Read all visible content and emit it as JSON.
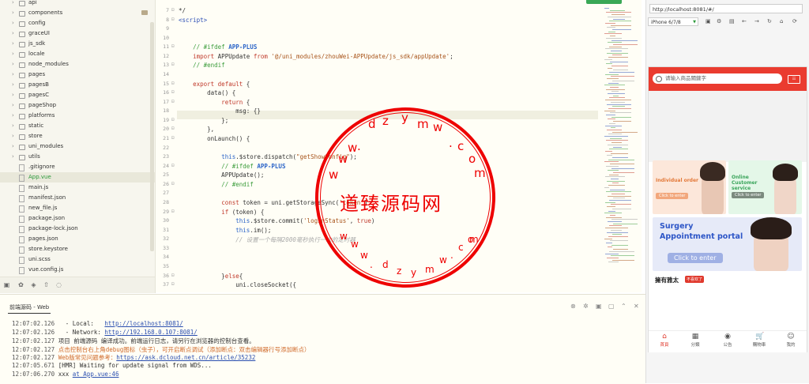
{
  "sidebar": {
    "items": [
      {
        "label": "api",
        "type": "folder"
      },
      {
        "label": "components",
        "type": "folder"
      },
      {
        "label": "config",
        "type": "folder"
      },
      {
        "label": "graceUI",
        "type": "folder"
      },
      {
        "label": "js_sdk",
        "type": "folder"
      },
      {
        "label": "locale",
        "type": "folder"
      },
      {
        "label": "node_modules",
        "type": "folder"
      },
      {
        "label": "pages",
        "type": "folder"
      },
      {
        "label": "pagesB",
        "type": "folder"
      },
      {
        "label": "pagesC",
        "type": "folder"
      },
      {
        "label": "pageShop",
        "type": "folder"
      },
      {
        "label": "platforms",
        "type": "folder"
      },
      {
        "label": "static",
        "type": "folder"
      },
      {
        "label": "store",
        "type": "folder"
      },
      {
        "label": "uni_modules",
        "type": "folder"
      },
      {
        "label": "utils",
        "type": "folder"
      },
      {
        "label": ".gitignore",
        "type": "file"
      },
      {
        "label": "App.vue",
        "type": "file"
      },
      {
        "label": "main.js",
        "type": "file"
      },
      {
        "label": "manifest.json",
        "type": "file"
      },
      {
        "label": "new_file.js",
        "type": "file"
      },
      {
        "label": "package.json",
        "type": "file"
      },
      {
        "label": "package-lock.json",
        "type": "file"
      },
      {
        "label": "pages.json",
        "type": "file"
      },
      {
        "label": "store.keystore",
        "type": "file"
      },
      {
        "label": "uni.scss",
        "type": "file"
      },
      {
        "label": "vue.config.js",
        "type": "file"
      }
    ]
  },
  "editor": {
    "lines": [
      {
        "n": "7",
        "f": "⊟",
        "html": "*/"
      },
      {
        "n": "8",
        "f": "⊟",
        "html": "<span class='c-tag'>&lt;script&gt;</span>"
      },
      {
        "n": "9",
        "f": "",
        "html": ""
      },
      {
        "n": "10",
        "f": "",
        "html": ""
      },
      {
        "n": "11",
        "f": "⊟",
        "html": "    <span class='c-cm'>// #ifdef <b class='c-blue'>APP-PLUS</b></span>"
      },
      {
        "n": "12",
        "f": "",
        "html": "    <span class='c-kw'>import</span> APPUpdate <span class='c-kw'>from</span> <span class='c-str'>'@/uni_modules/zhouWei-APPUpdate/js_sdk/appUpdate'</span>;"
      },
      {
        "n": "13",
        "f": "⊟",
        "html": "    <span class='c-cm'>// #endif</span>"
      },
      {
        "n": "14",
        "f": "",
        "html": ""
      },
      {
        "n": "15",
        "f": "⊟",
        "html": "    <span class='c-kw'>export default</span> {"
      },
      {
        "n": "16",
        "f": "⊟",
        "html": "        data() {"
      },
      {
        "n": "17",
        "f": "⊟",
        "html": "            <span class='c-kw'>return</span> {"
      },
      {
        "n": "18",
        "f": "",
        "html": "                msg: {}"
      },
      {
        "n": "19",
        "f": "⊟",
        "html": "            };"
      },
      {
        "n": "20",
        "f": "⊟",
        "html": "        },"
      },
      {
        "n": "21",
        "f": "⊟",
        "html": "        onLaunch() {"
      },
      {
        "n": "22",
        "f": "",
        "html": ""
      },
      {
        "n": "23",
        "f": "",
        "html": "            <span class='c-blue'>this</span>.$store.dispatch(<span class='c-str'>\"getShowConfig\"</span>);"
      },
      {
        "n": "24",
        "f": "⊟",
        "html": "            <span class='c-cm'>// #ifdef <b class='c-blue'>APP-PLUS</b></span>"
      },
      {
        "n": "25",
        "f": "",
        "html": "            APPUpdate();"
      },
      {
        "n": "26",
        "f": "⊟",
        "html": "            <span class='c-cm'>// #endif</span>"
      },
      {
        "n": "27",
        "f": "",
        "html": ""
      },
      {
        "n": "28",
        "f": "",
        "html": "            <span class='c-kw'>const</span> token = uni.getStorageSync(<span class='c-str'>'token'</span>)"
      },
      {
        "n": "29",
        "f": "⊟",
        "html": "            <span class='c-kw'>if</span> (token) {"
      },
      {
        "n": "30",
        "f": "",
        "html": "                <span class='c-blue'>this</span>.$store.commit(<span class='c-str'>'loginStatus'</span>, <span class='c-kw'>true</span>)"
      },
      {
        "n": "31",
        "f": "",
        "html": "                <span class='c-blue'>this</span>.im();"
      },
      {
        "n": "32",
        "f": "",
        "html": "                <span class='c-gray'>// 设置一个每隔2000毫秒执行一次的定时器</span>"
      },
      {
        "n": "33",
        "f": "",
        "html": ""
      },
      {
        "n": "34",
        "f": "",
        "html": ""
      },
      {
        "n": "35",
        "f": "",
        "html": ""
      },
      {
        "n": "36",
        "f": "⊟",
        "html": "            }<span class='c-kw'>else</span>{"
      },
      {
        "n": "37",
        "f": "⊟",
        "html": "                uni.closeSocket({"
      }
    ]
  },
  "watermark": {
    "main": "道臻源码网",
    "top_chars": [
      "d",
      "z",
      "y",
      "m",
      "w",
      ".",
      "c",
      "o",
      "m",
      "w",
      "w",
      "w",
      "."
    ],
    "bottom_chars": [
      "w",
      "w",
      "w",
      ".",
      "d",
      "z",
      "y",
      "m",
      "w",
      ".",
      "c",
      "o",
      "m"
    ]
  },
  "console": {
    "tab": "前端源码 - Web",
    "lines": [
      {
        "t": "12:07:02.126",
        "html": "  - Local:   <a>http://localhost:8081/</a>"
      },
      {
        "t": "12:07:02.126",
        "html": "  - Network: <a>http://192.168.0.107:8081/</a>"
      },
      {
        "t": "12:07:02.127",
        "html": "项目 前端源码 编译成功。前端运行日志，请另行在浏览器的控制台查看。"
      },
      {
        "t": "12:07:02.127",
        "html": "<span class='or'>点击控制台右上角debug图标（虫子），可开启断点调试（添加断点：双击编辑器行号添加断点）</span>"
      },
      {
        "t": "12:07:02.127",
        "html": "<span class='or'>Web版常见问题参考：</span><a>https://ask.dcloud.net.cn/article/35232</a>"
      },
      {
        "t": "12:07:05.671",
        "html": "[HMR] Waiting for update signal from WDS..."
      },
      {
        "t": "12:07:06.270",
        "html": "xxx <a>at App.vue:46</a>"
      }
    ]
  },
  "browser": {
    "url": "http://localhost:8081/#/",
    "device": "iPhone 6/7/8"
  },
  "phone": {
    "search_placeholder": "请输入商品關鍵字",
    "card1_title": "Individual order",
    "card1_btn": "Click to enter",
    "card2_title": "Online Customer service",
    "card2_btn": "Click to enter",
    "card3_title": "Surgery Appointment portal",
    "card3_btn": "Click to enter",
    "shop_name": "擁有雅太",
    "shop_badge": "不喜欢了",
    "tabs": [
      {
        "label": "首頁",
        "icon": "home-icon",
        "glyph": "⌂"
      },
      {
        "label": "分類",
        "icon": "grid-icon",
        "glyph": "▦"
      },
      {
        "label": "公告",
        "icon": "notice-icon",
        "glyph": "◉"
      },
      {
        "label": "購物車",
        "icon": "cart-icon",
        "glyph": "🛒"
      },
      {
        "label": "我的",
        "icon": "user-icon",
        "glyph": "☺"
      }
    ]
  },
  "colors": {
    "accent": "#ea3b2f",
    "watermark": "#ee0000",
    "link": "#2b4fb0"
  }
}
